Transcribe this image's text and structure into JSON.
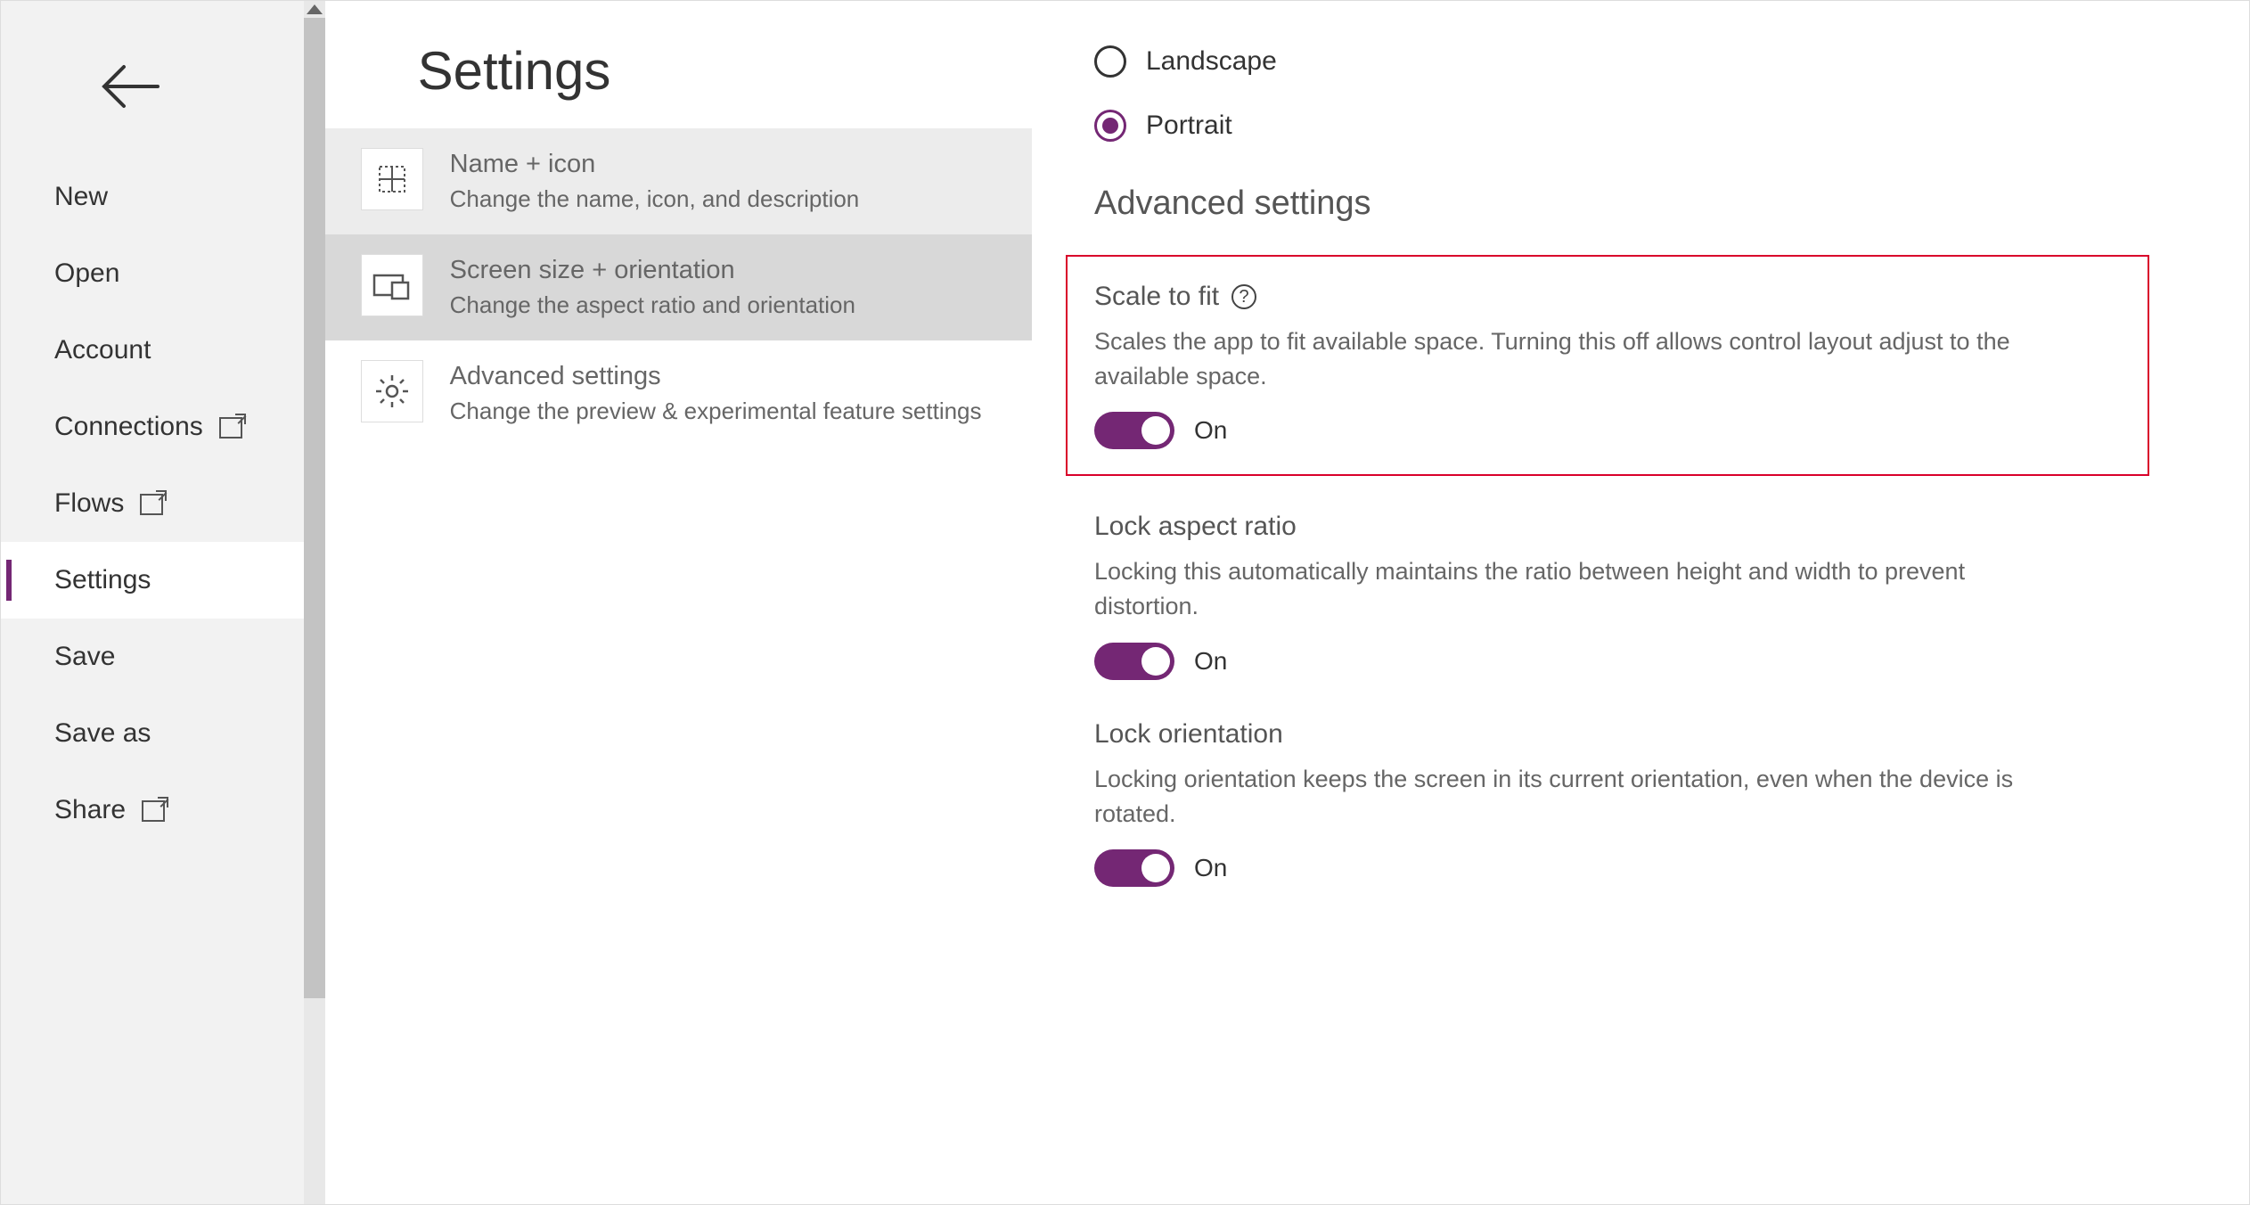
{
  "page_title": "Settings",
  "sidebar": {
    "items": [
      {
        "label": "New",
        "has_ext": false
      },
      {
        "label": "Open",
        "has_ext": false
      },
      {
        "label": "Account",
        "has_ext": false
      },
      {
        "label": "Connections",
        "has_ext": true
      },
      {
        "label": "Flows",
        "has_ext": true
      },
      {
        "label": "Settings",
        "has_ext": false,
        "active": true
      },
      {
        "label": "Save",
        "has_ext": false
      },
      {
        "label": "Save as",
        "has_ext": false
      },
      {
        "label": "Share",
        "has_ext": true
      }
    ]
  },
  "categories": [
    {
      "title": "Name + icon",
      "desc": "Change the name, icon, and description",
      "icon": "name-icon",
      "state": "hover"
    },
    {
      "title": "Screen size + orientation",
      "desc": "Change the aspect ratio and orientation",
      "icon": "screen-icon",
      "state": "selected"
    },
    {
      "title": "Advanced settings",
      "desc": "Change the preview & experimental feature settings",
      "icon": "gear-icon",
      "state": "normal"
    }
  ],
  "orientation": {
    "options": [
      {
        "label": "Landscape",
        "checked": false
      },
      {
        "label": "Portrait",
        "checked": true
      }
    ]
  },
  "advanced_section_title": "Advanced settings",
  "settings": {
    "scale_to_fit": {
      "title": "Scale to fit",
      "desc": "Scales the app to fit available space. Turning this off allows control layout adjust to the available space.",
      "state_label": "On",
      "has_help": true,
      "highlighted": true
    },
    "lock_aspect": {
      "title": "Lock aspect ratio",
      "desc": "Locking this automatically maintains the ratio between height and width to prevent distortion.",
      "state_label": "On"
    },
    "lock_orientation": {
      "title": "Lock orientation",
      "desc": "Locking orientation keeps the screen in its current orientation, even when the device is rotated.",
      "state_label": "On"
    }
  }
}
